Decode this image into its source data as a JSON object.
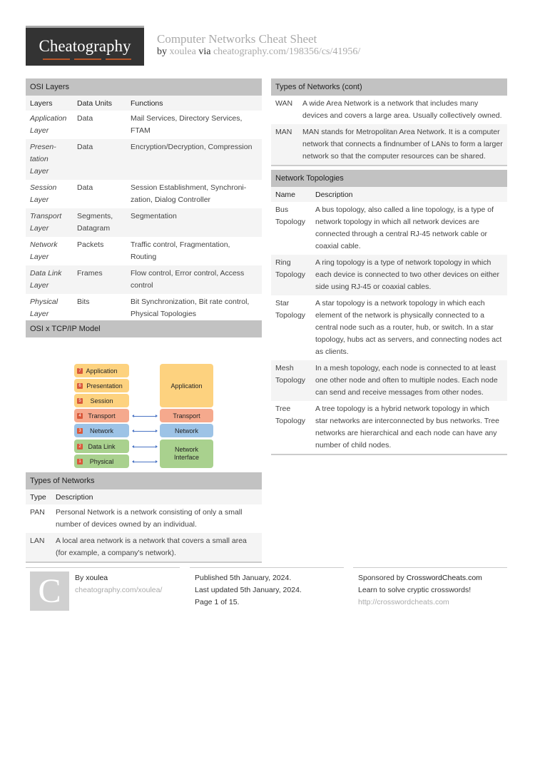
{
  "header": {
    "logo_text": "Cheatography",
    "title": "Computer Networks Cheat Sheet",
    "by_label": "by",
    "author": "xoulea",
    "via_label": "via",
    "url": "cheatography.com/198356/cs/41956/"
  },
  "osi_layers": {
    "title": "OSI Layers",
    "columns": [
      "Layers",
      "Data Units",
      "Functions"
    ],
    "rows": [
      {
        "layer": "Application Layer",
        "unit": "Data",
        "functions": "Mail Services, Directory Services, FTAM"
      },
      {
        "layer": "Presen- tation Layer",
        "unit": "Data",
        "functions": "Encryption/Decryption, Compression"
      },
      {
        "layer": "Session Layer",
        "unit": "Data",
        "functions": "Session Establishment, Synchroni- zation, Dialog Controller"
      },
      {
        "layer": "Transport Layer",
        "unit": "Segments, Datagram",
        "functions": "Segmentation"
      },
      {
        "layer": "Network Layer",
        "unit": "Packets",
        "functions": "Traffic control, Fragmentation, Routing"
      },
      {
        "layer": "Data Link Layer",
        "unit": "Frames",
        "functions": "Flow control, Error control, Access control"
      },
      {
        "layer": "Physical Layer",
        "unit": "Bits",
        "functions": "Bit Synchronization, Bit rate control, Physical Topologies"
      }
    ]
  },
  "osi_tcp": {
    "title": "OSI x TCP/IP Model",
    "osi": [
      {
        "num": "7",
        "label": "Application"
      },
      {
        "num": "6",
        "label": "Presentation"
      },
      {
        "num": "5",
        "label": "Session"
      },
      {
        "num": "4",
        "label": "Transport"
      },
      {
        "num": "3",
        "label": "Network"
      },
      {
        "num": "2",
        "label": "Data Link"
      },
      {
        "num": "1",
        "label": "Physical"
      }
    ],
    "tcp": [
      "Application",
      "Transport",
      "Network",
      "Network Interface"
    ],
    "colors": {
      "orange": "#fdd27f",
      "salmon": "#f5a98d",
      "blue": "#9dc3e6",
      "green": "#a9d18e",
      "badge": "#d9583a",
      "arrow": "#4a74c4"
    }
  },
  "types_of_networks": {
    "title": "Types of Networks",
    "columns": [
      "Type",
      "Description"
    ],
    "rows": [
      {
        "type": "PAN",
        "desc": "Personal Network is a network consisting of only a small number of devices owned by an individual."
      },
      {
        "type": "LAN",
        "desc": "A local area network is a network that covers a small area (for example, a company's network)."
      }
    ]
  },
  "types_of_networks_cont": {
    "title": "Types of Networks (cont)",
    "rows": [
      {
        "type": "WAN",
        "desc": "A wide Area Network is a network that includes many devices and covers a large area. Usually collectively owned."
      },
      {
        "type": "MAN",
        "desc": "MAN stands for Metropolitan Area Network. It is a computer network that connects a findnumber of LANs to form a larger network so that the computer resources can be shared."
      }
    ]
  },
  "topologies": {
    "title": "Network Topologies",
    "columns": [
      "Name",
      "Description"
    ],
    "rows": [
      {
        "name": "Bus Topology",
        "desc": "A bus topology, also called a line topology, is a type of network topology in which all network devices are connected through a central RJ-45 network cable or coaxial cable."
      },
      {
        "name": "Ring Topology",
        "desc": "A ring topology is a type of network topology in which each device is connected to two other devices on either side using RJ-45 or coaxial cables."
      },
      {
        "name": "Star Topology",
        "desc": "A star topology is a network topology in which each element of the network is physically connected to a central node such as a router, hub, or switch. In a star topology, hubs act as servers, and connecting nodes act as clients."
      },
      {
        "name": "Mesh Topology",
        "desc": "In a mesh topology, each node is connected to at least one other node and often to multiple nodes. Each node can send and receive messages from other nodes."
      },
      {
        "name": "Tree Topology",
        "desc": "A tree topology is a hybrid network topology in which star networks are interconnected by bus networks. Tree networks are hierarchical and each node can have any number of child nodes."
      }
    ]
  },
  "footer": {
    "avatar_letter": "C",
    "by_label": "By",
    "author": "xoulea",
    "author_url": "cheatography.com/xoulea/",
    "published": "Published 5th January, 2024.",
    "updated": "Last updated 5th January, 2024.",
    "page": "Page 1 of 15.",
    "sponsored_label": "Sponsored by",
    "sponsor": "CrosswordCheats.com",
    "sponsor_tagline": "Learn to solve cryptic crosswords!",
    "sponsor_url": "http://crosswordcheats.com"
  }
}
